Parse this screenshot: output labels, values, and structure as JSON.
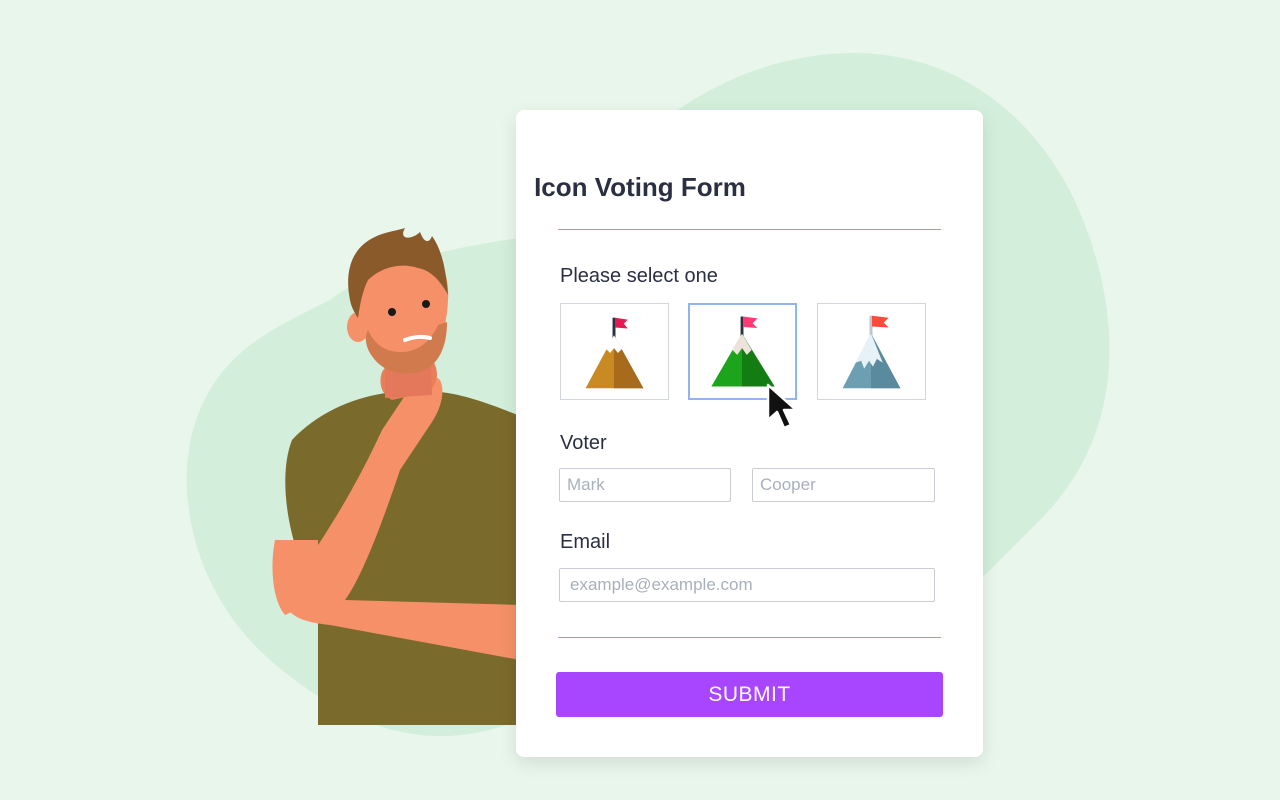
{
  "form": {
    "title": "Icon Voting Form",
    "select_label": "Please select one",
    "choices": [
      {
        "icon": "mountain-flag-brown-icon",
        "selected": false
      },
      {
        "icon": "mountain-flag-green-icon",
        "selected": true
      },
      {
        "icon": "mountain-flag-snowy-blue-icon",
        "selected": false
      }
    ],
    "voter_label": "Voter",
    "first_name_placeholder": "Mark",
    "last_name_placeholder": "Cooper",
    "email_label": "Email",
    "email_placeholder": "example@example.com",
    "submit_label": "SUBMIT"
  },
  "colors": {
    "background": "#e8f6ec",
    "blob": "#d3efdb",
    "accent": "#a846ff",
    "divider": "#d77be0",
    "selected_border": "#8fb6f2"
  }
}
